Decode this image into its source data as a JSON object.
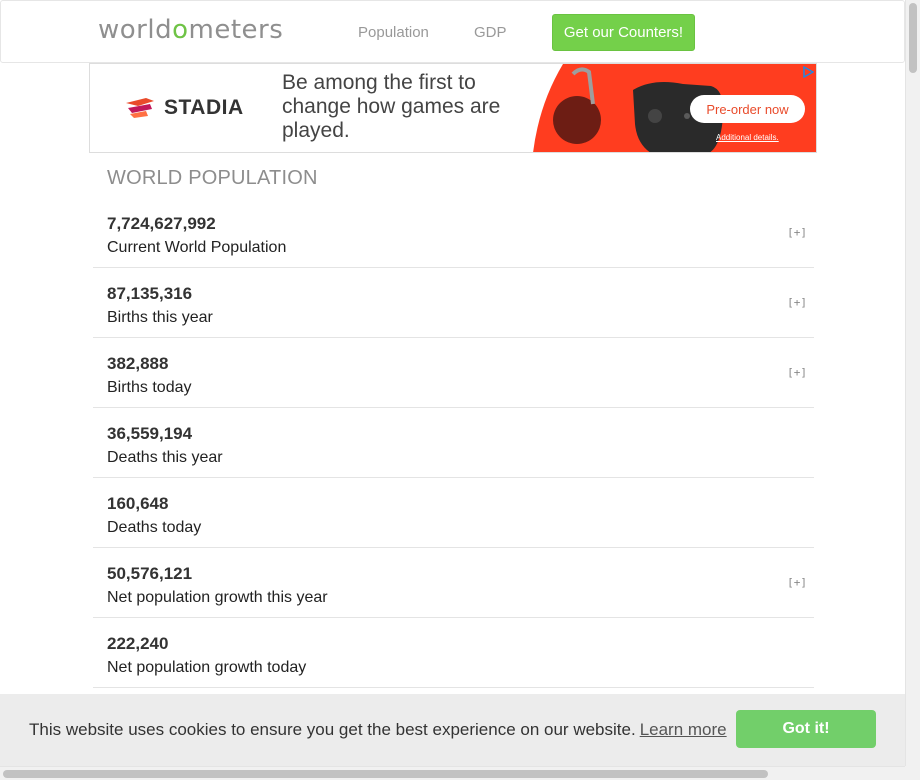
{
  "header": {
    "logo_parts": [
      "world",
      "o",
      "meters"
    ],
    "nav": [
      {
        "label": "Population"
      },
      {
        "label": "GDP"
      }
    ],
    "cta_label": "Get our Counters!"
  },
  "ad": {
    "brand": "STADIA",
    "tagline": "Be among the first to change how games are played.",
    "button_label": "Pre-order now",
    "details_label": "Additional details.",
    "accent_color": "#ff3d1f"
  },
  "population": {
    "title": "WORLD POPULATION",
    "expand_label": "[+]",
    "rows": [
      {
        "value": "7,724,627,992",
        "label": "Current World Population",
        "expandable": true
      },
      {
        "value": "87,135,316",
        "label": "Births this year",
        "expandable": true
      },
      {
        "value": "382,888",
        "label": "Births today",
        "expandable": true
      },
      {
        "value": "36,559,194",
        "label": "Deaths this year",
        "expandable": false
      },
      {
        "value": "160,648",
        "label": "Deaths today",
        "expandable": false
      },
      {
        "value": "50,576,121",
        "label": "Net population growth this year",
        "expandable": true
      },
      {
        "value": "222,240",
        "label": "Net population growth today",
        "expandable": false
      }
    ]
  },
  "cookie": {
    "message": "This website uses cookies to ensure you get the best experience on our website.",
    "learn_more": "Learn more",
    "accept_label": "Got it!"
  },
  "colors": {
    "brand_green": "#74d04a",
    "cookie_button": "#72cf6a",
    "title_gray": "#8d8d8d"
  }
}
